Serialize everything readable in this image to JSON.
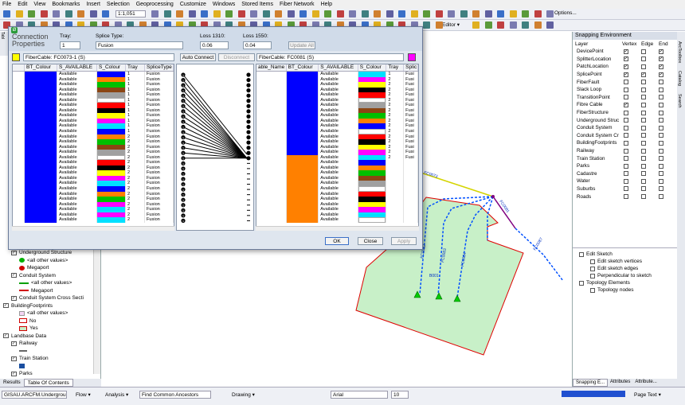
{
  "menu": [
    "File",
    "Edit",
    "View",
    "Bookmarks",
    "Insert",
    "Selection",
    "Geoprocessing",
    "Customize",
    "Windows",
    "Stored Items",
    "Fiber Network",
    "Help"
  ],
  "toolbar": {
    "scale": "1:1,051",
    "editor": "Editor ▾",
    "options": "Options..."
  },
  "dialog": {
    "title_line1": "Connection",
    "title_line2": "Properties",
    "tray_label": "Tray:",
    "tray_value": "1",
    "splice_type_label": "Splice Type:",
    "splice_type_value": "Fusion",
    "loss1310_label": "Loss 1310:",
    "loss1310_value": "0.06",
    "loss1550_label": "Loss 1550:",
    "loss1550_value": "0.04",
    "update_all": "Update All",
    "left_cable": "FiberCable: FC0073-1 (S)",
    "right_cable": "FiberCable: FC0081 (S)",
    "auto_connect": "Auto Connect",
    "disconnect": "Disconnect",
    "ok": "OK",
    "close": "Close",
    "apply": "Apply",
    "left_headers": [
      "BT_Colour",
      "S_AVAILABLE",
      "S_Colour",
      "Tray",
      "SpliceType"
    ],
    "right_headers": [
      "able_Name",
      "BT_Colour",
      "S_AVAILABLE",
      "S_Colour",
      "Tray",
      "Splic"
    ],
    "left_rows": [
      {
        "bt": "#0000ff",
        "avail": "Available",
        "s": "#0000ff",
        "tray": "1",
        "type": "Fusion"
      },
      {
        "bt": "#0000ff",
        "avail": "Available",
        "s": "#ff8000",
        "tray": "1",
        "type": "Fusion"
      },
      {
        "bt": "#0000ff",
        "avail": "Available",
        "s": "#00c000",
        "tray": "1",
        "type": "Fusion"
      },
      {
        "bt": "#0000ff",
        "avail": "Available",
        "s": "#8b4513",
        "tray": "1",
        "type": "Fusion"
      },
      {
        "bt": "#0000ff",
        "avail": "Available",
        "s": "#a0a0a0",
        "tray": "1",
        "type": "Fusion"
      },
      {
        "bt": "#0000ff",
        "avail": "Available",
        "s": "#ffffff",
        "tray": "1",
        "type": "Fusion"
      },
      {
        "bt": "#0000ff",
        "avail": "Available",
        "s": "#ff0000",
        "tray": "1",
        "type": "Fusion"
      },
      {
        "bt": "#0000ff",
        "avail": "Available",
        "s": "#000000",
        "tray": "1",
        "type": "Fusion"
      },
      {
        "bt": "#0000ff",
        "avail": "Available",
        "s": "#ffff00",
        "tray": "1",
        "type": "Fusion"
      },
      {
        "bt": "#0000ff",
        "avail": "Available",
        "s": "#ff00ff",
        "tray": "1",
        "type": "Fusion"
      },
      {
        "bt": "#0000ff",
        "avail": "Available",
        "s": "#00e0ff",
        "tray": "1",
        "type": "Fusion"
      },
      {
        "bt": "#0000ff",
        "avail": "Available",
        "s": "#0000ff",
        "tray": "1",
        "type": "Fusion"
      },
      {
        "bt": "#0000ff",
        "avail": "Available",
        "s": "#ff8000",
        "tray": "2",
        "type": "Fusion"
      },
      {
        "bt": "#0000ff",
        "avail": "Available",
        "s": "#00c000",
        "tray": "2",
        "type": "Fusion"
      },
      {
        "bt": "#0000ff",
        "avail": "Available",
        "s": "#8b4513",
        "tray": "2",
        "type": "Fusion"
      },
      {
        "bt": "#0000ff",
        "avail": "Available",
        "s": "#a0a0a0",
        "tray": "2",
        "type": "Fusion"
      },
      {
        "bt": "#0000ff",
        "avail": "Available",
        "s": "#ffffff",
        "tray": "2",
        "type": "Fusion"
      },
      {
        "bt": "#0000ff",
        "avail": "Available",
        "s": "#ff0000",
        "tray": "2",
        "type": "Fusion"
      },
      {
        "bt": "#0000ff",
        "avail": "Available",
        "s": "#000000",
        "tray": "2",
        "type": "Fusion"
      },
      {
        "bt": "#0000ff",
        "avail": "Available",
        "s": "#ffff00",
        "tray": "2",
        "type": "Fusion"
      },
      {
        "bt": "#0000ff",
        "avail": "Available",
        "s": "#ff00ff",
        "tray": "2",
        "type": "Fusion"
      },
      {
        "bt": "#0000ff",
        "avail": "Available",
        "s": "#00e0ff",
        "tray": "2",
        "type": "Fusion"
      },
      {
        "bt": "#0000ff",
        "avail": "Available",
        "s": "#0000ff",
        "tray": "2",
        "type": "Fusion"
      },
      {
        "bt": "#0000ff",
        "avail": "Available",
        "s": "#ff8000",
        "tray": "2",
        "type": "Fusion"
      },
      {
        "bt": "#0000ff",
        "avail": "Available",
        "s": "#00c000",
        "tray": "2",
        "type": "Fusion"
      },
      {
        "bt": "#0000ff",
        "avail": "Available",
        "s": "#ff00ff",
        "tray": "2",
        "type": "Fusion"
      },
      {
        "bt": "#0000ff",
        "avail": "Available",
        "s": "#00e0ff",
        "tray": "2",
        "type": "Fusion"
      },
      {
        "bt": "#0000ff",
        "avail": "Available",
        "s": "#ff00ff",
        "tray": "2",
        "type": "Fusion"
      },
      {
        "bt": "#0000ff",
        "avail": "Available",
        "s": "#00e0ff",
        "tray": "2",
        "type": "Fusion"
      }
    ],
    "right_rows": [
      {
        "bt": "#0000ff",
        "avail": "Available",
        "s": "#00e0ff",
        "tray": "1",
        "type": "Fusi"
      },
      {
        "bt": "#0000ff",
        "avail": "Available",
        "s": "#ff00ff",
        "tray": "2",
        "type": "Fusi"
      },
      {
        "bt": "#0000ff",
        "avail": "Available",
        "s": "#ffff00",
        "tray": "2",
        "type": "Fusi"
      },
      {
        "bt": "#0000ff",
        "avail": "Available",
        "s": "#000000",
        "tray": "2",
        "type": "Fusi"
      },
      {
        "bt": "#0000ff",
        "avail": "Available",
        "s": "#ff0000",
        "tray": "2",
        "type": "Fusi"
      },
      {
        "bt": "#0000ff",
        "avail": "Available",
        "s": "#ffffff",
        "tray": "2",
        "type": "Fusi"
      },
      {
        "bt": "#0000ff",
        "avail": "Available",
        "s": "#a0a0a0",
        "tray": "2",
        "type": "Fusi"
      },
      {
        "bt": "#0000ff",
        "avail": "Available",
        "s": "#8b4513",
        "tray": "2",
        "type": "Fusi"
      },
      {
        "bt": "#0000ff",
        "avail": "Available",
        "s": "#00c000",
        "tray": "2",
        "type": "Fusi"
      },
      {
        "bt": "#0000ff",
        "avail": "Available",
        "s": "#ff8000",
        "tray": "2",
        "type": "Fusi"
      },
      {
        "bt": "#0000ff",
        "avail": "Available",
        "s": "#0000ff",
        "tray": "2",
        "type": "Fusi"
      },
      {
        "bt": "#0000ff",
        "avail": "Available",
        "s": "#ffffff",
        "tray": "2",
        "type": "Fusi"
      },
      {
        "bt": "#0000ff",
        "avail": "Available",
        "s": "#ff0000",
        "tray": "2",
        "type": "Fusi"
      },
      {
        "bt": "#0000ff",
        "avail": "Available",
        "s": "#000000",
        "tray": "2",
        "type": "Fusi"
      },
      {
        "bt": "#0000ff",
        "avail": "Available",
        "s": "#ffff00",
        "tray": "2",
        "type": "Fusi"
      },
      {
        "bt": "#0000ff",
        "avail": "Available",
        "s": "#ff00ff",
        "tray": "2",
        "type": "Fusi"
      },
      {
        "bt": "#ff8000",
        "avail": "Available",
        "s": "#00e0ff",
        "tray": "2",
        "type": "Fusi"
      },
      {
        "bt": "#ff8000",
        "avail": "Available",
        "s": "#0000ff",
        "tray": "",
        "type": ""
      },
      {
        "bt": "#ff8000",
        "avail": "Available",
        "s": "#ff8000",
        "tray": "",
        "type": ""
      },
      {
        "bt": "#ff8000",
        "avail": "Available",
        "s": "#00c000",
        "tray": "",
        "type": ""
      },
      {
        "bt": "#ff8000",
        "avail": "Available",
        "s": "#8b4513",
        "tray": "",
        "type": ""
      },
      {
        "bt": "#ff8000",
        "avail": "Available",
        "s": "#a0a0a0",
        "tray": "",
        "type": ""
      },
      {
        "bt": "#ff8000",
        "avail": "Available",
        "s": "#ffffff",
        "tray": "",
        "type": ""
      },
      {
        "bt": "#ff8000",
        "avail": "Available",
        "s": "#ff0000",
        "tray": "",
        "type": ""
      },
      {
        "bt": "#ff8000",
        "avail": "Available",
        "s": "#000000",
        "tray": "",
        "type": ""
      },
      {
        "bt": "#ff8000",
        "avail": "Available",
        "s": "#ffff00",
        "tray": "",
        "type": ""
      },
      {
        "bt": "#ff8000",
        "avail": "Available",
        "s": "#ff00ff",
        "tray": "",
        "type": ""
      },
      {
        "bt": "#ff8000",
        "avail": "Available",
        "s": "#00e0ff",
        "tray": "",
        "type": ""
      },
      {
        "bt": "#ff8000",
        "avail": "Available",
        "s": "#ffffff",
        "tray": "",
        "type": ""
      }
    ],
    "splice_marker": "1"
  },
  "snapping": {
    "title": "Snapping Environment",
    "headers": [
      "Layer",
      "Vertex",
      "Edge",
      "End"
    ],
    "layers": [
      {
        "name": "DevicePoint",
        "v": true,
        "e": false,
        "n": true
      },
      {
        "name": "SplitterLocation",
        "v": true,
        "e": false,
        "n": true
      },
      {
        "name": "PatchLocation",
        "v": true,
        "e": false,
        "n": true
      },
      {
        "name": "SplicePoint",
        "v": true,
        "e": true,
        "n": true
      },
      {
        "name": "FiberFault",
        "v": false,
        "e": false,
        "n": false
      },
      {
        "name": "Slack Loop",
        "v": false,
        "e": false,
        "n": false
      },
      {
        "name": "TransitionPoint",
        "v": false,
        "e": false,
        "n": false
      },
      {
        "name": "Fibre Cable",
        "v": true,
        "e": false,
        "n": false
      },
      {
        "name": "FiberStructure",
        "v": false,
        "e": false,
        "n": false
      },
      {
        "name": "Underground Struc",
        "v": false,
        "e": false,
        "n": false
      },
      {
        "name": "Conduit System",
        "v": false,
        "e": false,
        "n": false
      },
      {
        "name": "Conduit System Cr",
        "v": false,
        "e": false,
        "n": false
      },
      {
        "name": "BuildingFootprints",
        "v": false,
        "e": false,
        "n": false
      },
      {
        "name": "Railway",
        "v": false,
        "e": false,
        "n": false
      },
      {
        "name": "Train Station",
        "v": false,
        "e": false,
        "n": false
      },
      {
        "name": "Parks",
        "v": false,
        "e": false,
        "n": false
      },
      {
        "name": "Cadastre",
        "v": false,
        "e": false,
        "n": false
      },
      {
        "name": "Water",
        "v": false,
        "e": false,
        "n": false
      },
      {
        "name": "Suburbs",
        "v": false,
        "e": false,
        "n": false
      },
      {
        "name": "Roads",
        "v": false,
        "e": false,
        "n": false
      }
    ],
    "tree": [
      "Edit Sketch",
      "Edit sketch vertices",
      "Edit sketch edges",
      "Perpendicular to sketch",
      "Topology Elements",
      "Topology nodes"
    ],
    "tabs": [
      "Snapping E...",
      "Attributes",
      "Attribute..."
    ]
  },
  "toc": {
    "rows": [
      {
        "label": "Underground Structure",
        "indent": 1,
        "type": "layer"
      },
      {
        "label": "<all other values>",
        "indent": 2,
        "type": "sym-green-dot"
      },
      {
        "label": "Megaport",
        "indent": 2,
        "type": "sym-red-dot"
      },
      {
        "label": "Conduit System",
        "indent": 1,
        "type": "layer"
      },
      {
        "label": "<all other values>",
        "indent": 2,
        "type": "sym-green-line"
      },
      {
        "label": "Megaport",
        "indent": 2,
        "type": "sym-red-line"
      },
      {
        "label": "Conduit System Cross Secti",
        "indent": 1,
        "type": "layer"
      },
      {
        "label": "BuildingFootprints",
        "indent": 0,
        "type": "layer"
      },
      {
        "label": "<all other values>",
        "indent": 2,
        "type": "sym-box"
      },
      {
        "label": "No",
        "indent": 2,
        "type": "sym-redbox"
      },
      {
        "label": "Yes",
        "indent": 2,
        "type": "sym-greenbox"
      },
      {
        "label": "Landbase Data",
        "indent": 0,
        "type": "layer"
      },
      {
        "label": "Railway",
        "indent": 1,
        "type": "layer"
      },
      {
        "label": "",
        "indent": 2,
        "type": "sym-rail"
      },
      {
        "label": "Train Station",
        "indent": 1,
        "type": "layer"
      },
      {
        "label": "",
        "indent": 2,
        "type": "sym-station"
      },
      {
        "label": "Parks",
        "indent": 1,
        "type": "layer"
      }
    ],
    "tabs": [
      "Results",
      "Table Of Contents"
    ]
  },
  "map": {
    "labels": [
      "FC0073",
      "FC0081",
      "FC0087",
      "FC0082",
      "FC0083",
      "FC0084",
      "B001"
    ]
  },
  "status": {
    "workspace": "GISAU.ARCFM.Underground",
    "flow": "Flow ▾",
    "analysis": "Analysis ▾",
    "find": "Find Common Ancestors",
    "drawing": "Drawing ▾",
    "font": "Arial",
    "size": "10",
    "pagetext": "Page Text ▾"
  },
  "left_side_tabs": [
    "Tabl"
  ],
  "right_side_tabs": [
    "ArcToolbox",
    "Catalog",
    "Search"
  ]
}
